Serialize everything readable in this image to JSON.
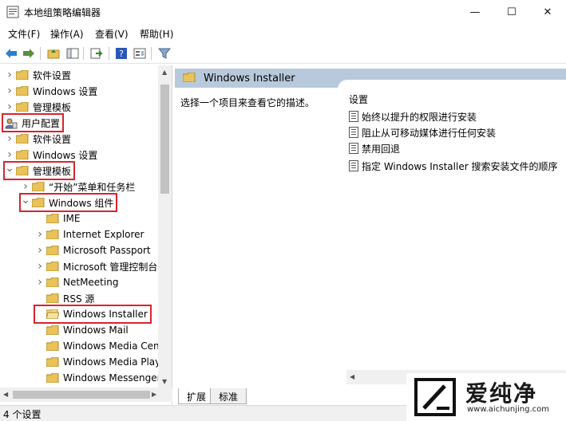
{
  "window": {
    "title": "本地组策略编辑器",
    "minimize": "—",
    "maximize": "☐",
    "close": "✕"
  },
  "menu": [
    "文件(F)",
    "操作(A)",
    "查看(V)",
    "帮助(H)"
  ],
  "tree": [
    {
      "label": "软件设置",
      "indent": 1,
      "chevron": "collapsed",
      "icon": "folder",
      "highlight": false
    },
    {
      "label": "Windows 设置",
      "indent": 1,
      "chevron": "collapsed",
      "icon": "folder",
      "highlight": false
    },
    {
      "label": "管理模板",
      "indent": 1,
      "chevron": "collapsed",
      "icon": "folder",
      "highlight": false
    },
    {
      "label": "用户配置",
      "indent": 0,
      "chevron": "none",
      "icon": "user-config",
      "highlight": true
    },
    {
      "label": "软件设置",
      "indent": 1,
      "chevron": "collapsed",
      "icon": "folder",
      "highlight": false
    },
    {
      "label": "Windows 设置",
      "indent": 1,
      "chevron": "collapsed",
      "icon": "folder",
      "highlight": false
    },
    {
      "label": "管理模板",
      "indent": 1,
      "chevron": "expanded",
      "icon": "folder",
      "highlight": true
    },
    {
      "label": "“开始”菜单和任务栏",
      "indent": 2,
      "chevron": "collapsed",
      "icon": "folder",
      "highlight": false
    },
    {
      "label": "Windows 组件",
      "indent": 2,
      "chevron": "expanded",
      "icon": "folder",
      "highlight": true
    },
    {
      "label": "IME",
      "indent": 3,
      "chevron": "none",
      "icon": "folder",
      "highlight": false
    },
    {
      "label": "Internet Explorer",
      "indent": 3,
      "chevron": "collapsed",
      "icon": "folder",
      "highlight": false
    },
    {
      "label": "Microsoft Passport",
      "indent": 3,
      "chevron": "collapsed",
      "icon": "folder",
      "highlight": false
    },
    {
      "label": "Microsoft 管理控制台",
      "indent": 3,
      "chevron": "collapsed",
      "icon": "folder",
      "highlight": false
    },
    {
      "label": "NetMeeting",
      "indent": 3,
      "chevron": "collapsed",
      "icon": "folder",
      "highlight": false
    },
    {
      "label": "RSS 源",
      "indent": 3,
      "chevron": "none",
      "icon": "folder",
      "highlight": false
    },
    {
      "label": "Windows Installer",
      "indent": 3,
      "chevron": "none",
      "icon": "folder-open",
      "highlight": true
    },
    {
      "label": "Windows Mail",
      "indent": 3,
      "chevron": "none",
      "icon": "folder",
      "highlight": false
    },
    {
      "label": "Windows Media Center",
      "indent": 3,
      "chevron": "none",
      "icon": "folder",
      "highlight": false
    },
    {
      "label": "Windows Media Player",
      "indent": 3,
      "chevron": "none",
      "icon": "folder",
      "highlight": false
    },
    {
      "label": "Windows Messenger",
      "indent": 3,
      "chevron": "none",
      "icon": "folder",
      "highlight": false
    }
  ],
  "right": {
    "header": "Windows Installer",
    "description": "选择一个项目来查看它的描述。",
    "column_header": "设置",
    "settings": [
      "始终以提升的权限进行安装",
      "阻止从可移动媒体进行任何安装",
      "禁用回退",
      "指定 Windows Installer 搜索安装文件的顺序"
    ]
  },
  "tabs": [
    "扩展",
    "标准"
  ],
  "status": "4 个设置",
  "watermark": {
    "brand": "爱纯净",
    "url": "www.aichunjing.com"
  },
  "colors": {
    "highlight": "#d9232e",
    "header_bg": "#b9c9dc",
    "folder": "#e8c25a"
  }
}
